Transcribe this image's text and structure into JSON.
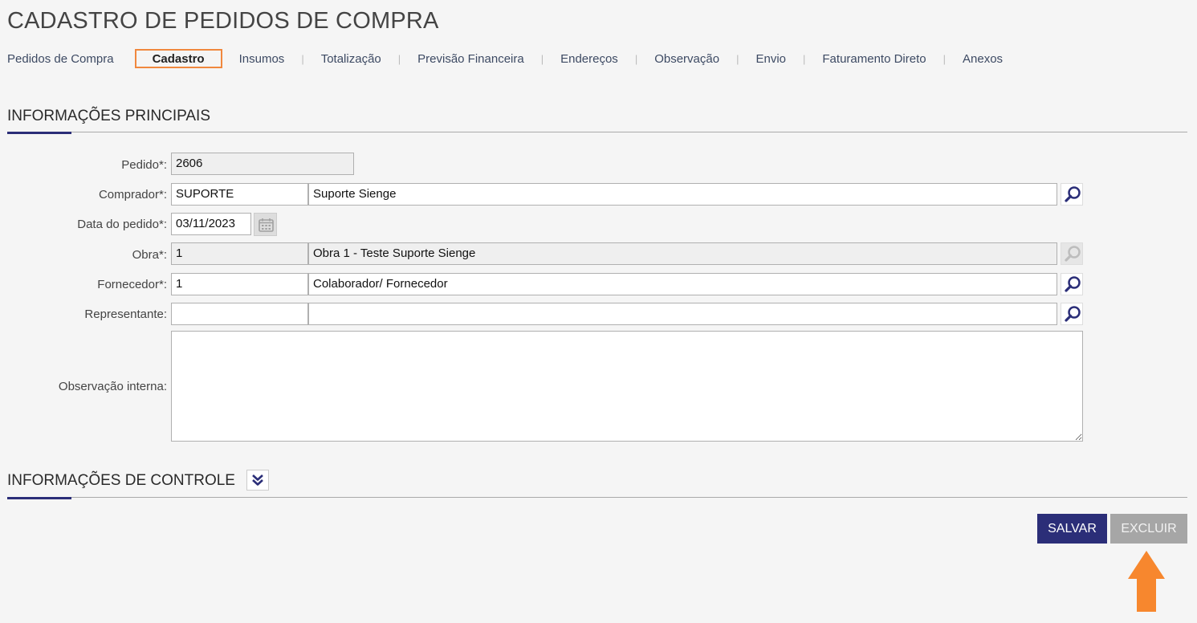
{
  "page": {
    "title": "CADASTRO DE PEDIDOS DE COMPRA"
  },
  "tabs": [
    {
      "label": "Pedidos de Compra"
    },
    {
      "label": "Cadastro",
      "active": true
    },
    {
      "label": "Insumos"
    },
    {
      "label": "Totalização"
    },
    {
      "label": "Previsão Financeira"
    },
    {
      "label": "Endereços"
    },
    {
      "label": "Observação"
    },
    {
      "label": "Envio"
    },
    {
      "label": "Faturamento Direto"
    },
    {
      "label": "Anexos"
    }
  ],
  "sections": {
    "main": "INFORMAÇÕES PRINCIPAIS",
    "control": "INFORMAÇÕES DE CONTROLE"
  },
  "form": {
    "pedido": {
      "label": "Pedido*:",
      "value": "2606"
    },
    "comprador": {
      "label": "Comprador*:",
      "code": "SUPORTE",
      "name": "Suporte Sienge"
    },
    "data_pedido": {
      "label": "Data do pedido*:",
      "value": "03/11/2023"
    },
    "obra": {
      "label": "Obra*:",
      "code": "1",
      "name": "Obra 1 - Teste Suporte Sienge"
    },
    "fornecedor": {
      "label": "Fornecedor*:",
      "code": "1",
      "name": "Colaborador/ Fornecedor"
    },
    "representante": {
      "label": "Representante:",
      "code": "",
      "name": ""
    },
    "observacao_interna": {
      "label": "Observação interna:",
      "value": ""
    }
  },
  "buttons": {
    "save": "SALVAR",
    "delete": "EXCLUIR"
  },
  "icons": {
    "lookup": "magnifier-icon",
    "calendar": "calendar-icon",
    "expand": "double-chevron-down-icon",
    "annotation": "arrow-up-icon"
  },
  "colors": {
    "primary": "#2b2e78",
    "active_tab_border": "#f0883e",
    "annotation_arrow": "#f7872e",
    "disabled_button": "#a6a6a6"
  }
}
